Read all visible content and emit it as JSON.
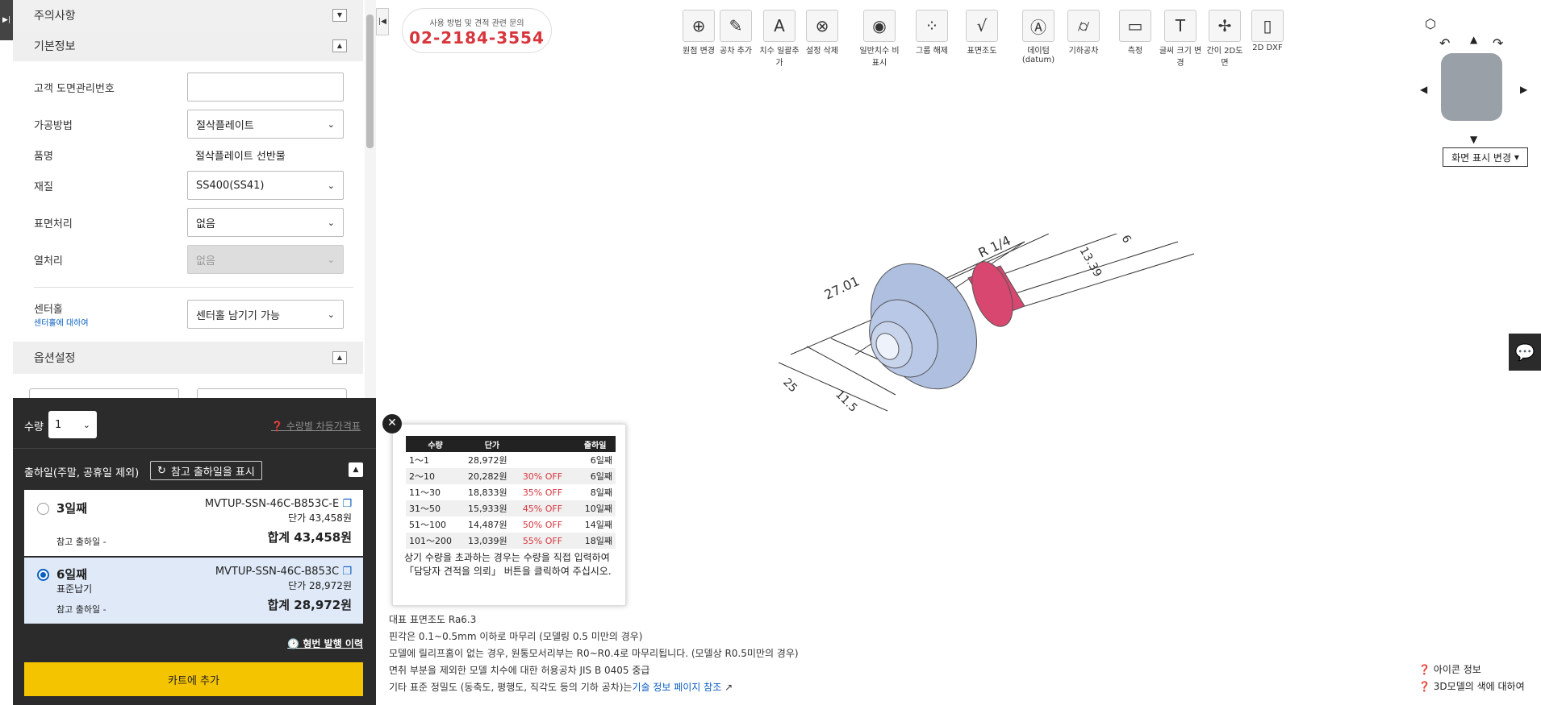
{
  "left": {
    "edge_tab": "▶|",
    "sections": {
      "notice": "주의사항",
      "basic": "기본정보",
      "options": "옵션설정"
    },
    "fields": {
      "drawing_no_label": "고객 도면관리번호",
      "drawing_no_value": "",
      "process_label": "가공방법",
      "process_value": "절삭플레이트",
      "item_label": "품명",
      "item_value": "절삭플레이트 선반물",
      "material_label": "재질",
      "material_value": "SS400(SS41)",
      "surface_label": "표면처리",
      "surface_value": "없음",
      "heat_label": "열처리",
      "heat_value": "없음",
      "center_label": "센터홀",
      "center_link": "센터홀에 대하여",
      "center_value": "센터홀 남기기 가능"
    },
    "qty": {
      "label": "수량",
      "value": "1",
      "price_link": "수량별 차등가격표"
    },
    "ship": {
      "label": "출하일(주말, 공휴일 제외)",
      "ref_button": "참고 출하일을 표시"
    },
    "cards": [
      {
        "days": "3일째",
        "sub": "",
        "code": "MVTUP-SSN-46C-B853C-E",
        "unit": "단가 43,458원",
        "ref": "참고 출하일 -",
        "total": "합계 43,458원"
      },
      {
        "days": "6일째",
        "sub": "표준납기",
        "code": "MVTUP-SSN-46C-B853C",
        "unit": "단가 28,972원",
        "ref": "참고 출하일 -",
        "total": "합계 28,972원"
      }
    ],
    "history_link": "형번 발행 이력",
    "cart_button": "카트에 추가"
  },
  "contact": {
    "caption": "사용 방법 및 견적 관련 문의",
    "phone": "02-2184-3554"
  },
  "toolbar": [
    {
      "label": "원점 변경",
      "icon": "origin-icon",
      "glyph": "⊕"
    },
    {
      "label": "공차 추가",
      "icon": "tolerance-add-icon",
      "glyph": "✎"
    },
    {
      "label": "치수 일괄추가",
      "icon": "dimension-add-icon",
      "glyph": "A"
    },
    {
      "label": "설정 삭제",
      "icon": "delete-setting-icon",
      "glyph": "⊗"
    },
    {
      "label": "일반치수 비표시",
      "icon": "hide-dimension-icon",
      "glyph": "◉"
    },
    {
      "label": "그룹 해제",
      "icon": "ungroup-icon",
      "glyph": "⁘"
    },
    {
      "label": "표면조도",
      "icon": "surface-roughness-icon",
      "glyph": "√"
    },
    {
      "label": "데이텀 (datum)",
      "icon": "datum-icon",
      "glyph": "Ⓐ"
    },
    {
      "label": "기하공차",
      "icon": "geometric-tolerance-icon",
      "glyph": "⌭"
    },
    {
      "label": "측정",
      "icon": "measure-icon",
      "glyph": "▭"
    },
    {
      "label": "글씨 크기 변경",
      "icon": "font-size-icon",
      "glyph": "T"
    },
    {
      "label": "간이 2D도면",
      "icon": "simple-2d-icon",
      "glyph": "✢"
    },
    {
      "label": "2D DXF",
      "icon": "dxf-icon",
      "glyph": "▯"
    }
  ],
  "view": {
    "display_change": "화면 표시 변경"
  },
  "price_table": {
    "headers": [
      "수량",
      "단가",
      "",
      "출하일"
    ],
    "rows": [
      [
        "1～1",
        "28,972원",
        "",
        "6일째"
      ],
      [
        "2～10",
        "20,282원",
        "30% OFF",
        "6일째"
      ],
      [
        "11～30",
        "18,833원",
        "35% OFF",
        "8일째"
      ],
      [
        "31～50",
        "15,933원",
        "45% OFF",
        "10일째"
      ],
      [
        "51～100",
        "14,487원",
        "50% OFF",
        "14일째"
      ],
      [
        "101～200",
        "13,039원",
        "55% OFF",
        "18일째"
      ]
    ],
    "note": "상기 수량을 초과하는 경우는 수량을 직접 입력하여 「담당자 견적을 의뢰」 버튼을 클릭하여 주십시오."
  },
  "drawing": {
    "dim1": "27.01",
    "dim2": "R 1/4",
    "dim3": "13.39",
    "dim4": "6",
    "dim5": "11.5",
    "dim6": "25"
  },
  "notes": {
    "line1": "대표 표면조도 Ra6.3",
    "line2": "핀각은 0.1~0.5mm 이하로 마무리 (모델링 0.5 미만의 경우)",
    "line3": "모델에 릴리프홈이 없는 경우, 원통모서리부는 R0~R0.4로 마무리됩니다. (모델상 R0.5미만의 경우)",
    "line4": "면취 부분을 제외한 모델 치수에 대한 허용공차 JIS B 0405 중급",
    "line5": "기타 표준 정밀도 (동축도, 평행도, 직각도 등의 기하 공차)는",
    "line5_link": "기술 정보 페이지 참조"
  },
  "help": {
    "icon_info": "아이콘 정보",
    "color_info": "3D모델의 색에 대하여"
  },
  "colors": {
    "accent": "#f5c400",
    "dark": "#2b2b2b",
    "pink": "#d8476f",
    "part": "#aebfe0",
    "phone": "#d8353c"
  }
}
